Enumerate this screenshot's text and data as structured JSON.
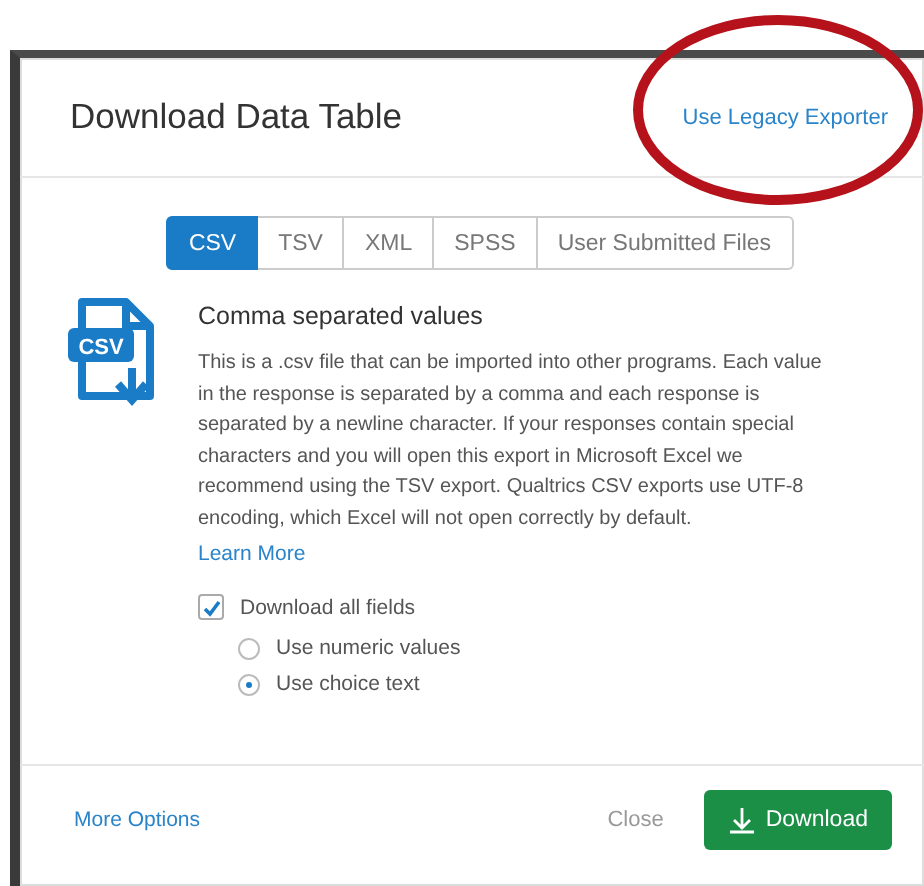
{
  "dialog": {
    "title": "Download Data Table",
    "legacy_link": "Use Legacy Exporter"
  },
  "annotation": {
    "kind": "ellipse",
    "color": "#b5121b"
  },
  "tabs": [
    {
      "label": "CSV",
      "selected": true
    },
    {
      "label": "TSV",
      "selected": false
    },
    {
      "label": "XML",
      "selected": false
    },
    {
      "label": "SPSS",
      "selected": false
    },
    {
      "label": "User Submitted Files",
      "selected": false
    }
  ],
  "format": {
    "icon_label": "CSV",
    "heading": "Comma separated values",
    "description": "This is a .csv file that can be imported into other programs. Each value in the response is separated by a comma and each response is separated by a newline character. If your responses contain special characters and you will open this export in Microsoft Excel we recommend using the TSV export. Qualtrics CSV exports use UTF-8 encoding, which Excel will not open correctly by default.",
    "learn_more": "Learn More"
  },
  "download_all_fields": {
    "label": "Download all fields",
    "checked": true
  },
  "value_options": [
    {
      "label": "Use numeric values",
      "selected": false
    },
    {
      "label": "Use choice text",
      "selected": true
    }
  ],
  "footer": {
    "more_options": "More Options",
    "close": "Close",
    "download": "Download"
  }
}
